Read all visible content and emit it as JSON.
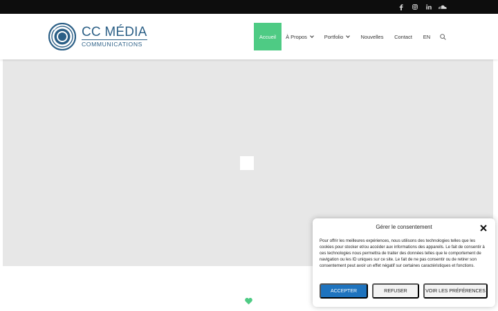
{
  "topbar": {
    "social": [
      {
        "name": "facebook-icon",
        "glyph": "f"
      },
      {
        "name": "instagram-icon",
        "glyph": "ig"
      },
      {
        "name": "linkedin-icon",
        "glyph": "in"
      },
      {
        "name": "soundcloud-icon",
        "glyph": "sc"
      }
    ]
  },
  "header": {
    "logo": {
      "title": "CC MÉDIA",
      "subtitle": "COMMUNICATIONS"
    },
    "nav": [
      {
        "label": "Accueil",
        "active": true
      },
      {
        "label": "À Propos",
        "dropdown": true
      },
      {
        "label": "Portfolio",
        "dropdown": true
      },
      {
        "label": "Nouvelles"
      },
      {
        "label": "Contact"
      },
      {
        "label": "EN"
      }
    ],
    "search_icon": "search-icon"
  },
  "colors": {
    "accent": "#4ecb84",
    "brand": "#2b5f86",
    "button_primary": "#1e73be",
    "topbar": "#0d0d0d",
    "hero_bg": "#e7e7e7"
  },
  "consent": {
    "title": "Gérer le consentement",
    "text": "Pour offrir les meilleures expériences, nous utilisons des technologies telles que les cookies pour stocker et/ou accéder aux informations des appareils. Le fait de consentir à ces technologies nous permettra de traiter des données telles que le comportement de navigation ou les ID uniques sur ce site. Le fait de ne pas consentir ou de retirer son consentement peut avoir un effet négatif sur certaines caractéristiques et fonctions.",
    "accept_label": "ACCEPTER",
    "refuse_label": "REFUSER",
    "prefs_label": "VOIR LES PRÉFÉRENCES"
  }
}
